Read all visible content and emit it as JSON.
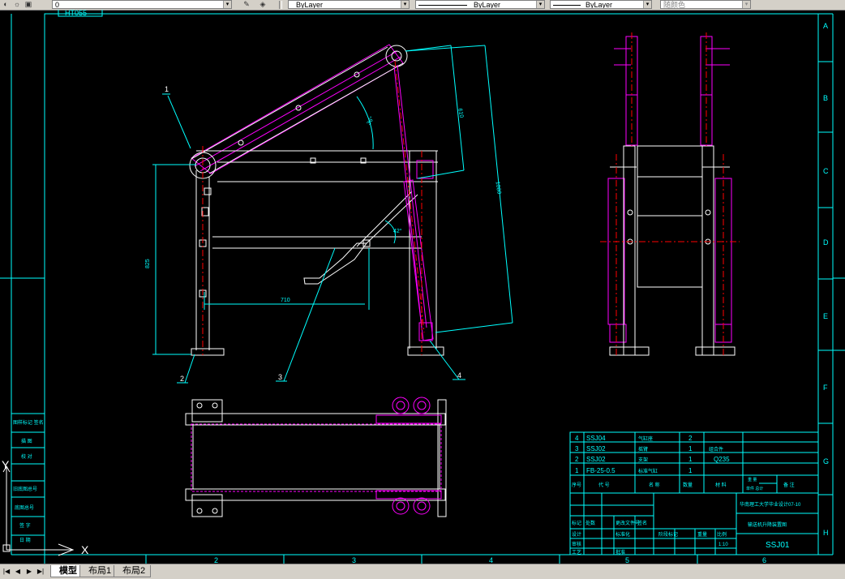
{
  "toolbar": {
    "layer_value": "0",
    "color_value": "ByLayer",
    "linetype_value": "ByLayer",
    "lineweight_value": "ByLayer",
    "plotstyle_value": "随颜色"
  },
  "drawing": {
    "top_label": "HT055",
    "grid_cols": [
      "2",
      "3",
      "4",
      "5",
      "6"
    ],
    "grid_rows": [
      "A",
      "B",
      "C",
      "D",
      "E",
      "F",
      "G",
      "H"
    ],
    "balloons": [
      "1",
      "2",
      "3",
      "4"
    ],
    "dims": {
      "height": "825",
      "width": "710",
      "slant1": "610",
      "slant2": "1080",
      "angle1": "36°",
      "angle2": "42°"
    },
    "left_strip": [
      "图样标记 签名",
      "描 图",
      "校 对",
      "旧底图总号",
      "底图总号",
      "签 字",
      "日 期"
    ],
    "ucs": {
      "y": "Y",
      "x": "X"
    }
  },
  "bom": {
    "rows": [
      {
        "no": "4",
        "code": "SSJ04",
        "name": "气缸座",
        "qty": "2",
        "material": ""
      },
      {
        "no": "3",
        "code": "SSJ02",
        "name": "摇臂",
        "qty": "1",
        "material": "组合件"
      },
      {
        "no": "2",
        "code": "SSJ02",
        "name": "支架",
        "qty": "1",
        "material": "Q235"
      },
      {
        "no": "1",
        "code": "FB-25-0.5",
        "name": "标准气缸",
        "qty": "1",
        "material": ""
      }
    ],
    "header": [
      "序号",
      "代 号",
      "名 称",
      "数量",
      "材 料",
      "单件 总计",
      "备 注"
    ],
    "header_extra": "重 量"
  },
  "title_block": {
    "school": "华南理工大学毕业设计07-10",
    "drawing_name": "输送机升降装置图",
    "drawing_no": "SSJ01",
    "small_labels": [
      "标记",
      "处数",
      "更改文件号",
      "签名",
      "日期",
      "设计",
      "标准化",
      "审核",
      "工艺",
      "批准",
      "阶段标记",
      "重量",
      "比例"
    ],
    "scale": "1:10"
  },
  "tabs": [
    "模型",
    "布局1",
    "布局2"
  ],
  "colors": {
    "frame": "#00ffff",
    "part": "#ffffff",
    "hidden": "#ff00ff",
    "center": "#ff0000",
    "dim": "#00ffff"
  }
}
